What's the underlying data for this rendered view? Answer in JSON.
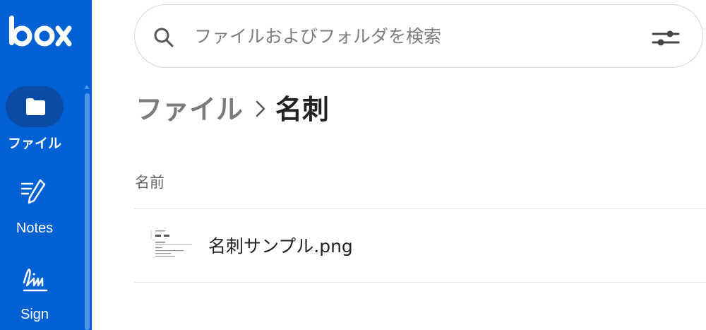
{
  "sidebar": {
    "logo_text": "box",
    "items": [
      {
        "label": "ファイル",
        "icon": "folder-icon",
        "active": true
      },
      {
        "label": "Notes",
        "icon": "notes-icon",
        "active": false
      },
      {
        "label": "Sign",
        "icon": "sign-icon",
        "active": false
      }
    ]
  },
  "search": {
    "placeholder": "ファイルおよびフォルダを検索",
    "value": ""
  },
  "breadcrumb": {
    "parent": "ファイル",
    "current": "名刺"
  },
  "list": {
    "columns": [
      "名前"
    ],
    "rows": [
      {
        "name": "名刺サンプル.png",
        "icon": "image-thumbnail"
      }
    ]
  },
  "colors": {
    "brand": "#0061d5",
    "active_pill": "#0a4ba6"
  }
}
